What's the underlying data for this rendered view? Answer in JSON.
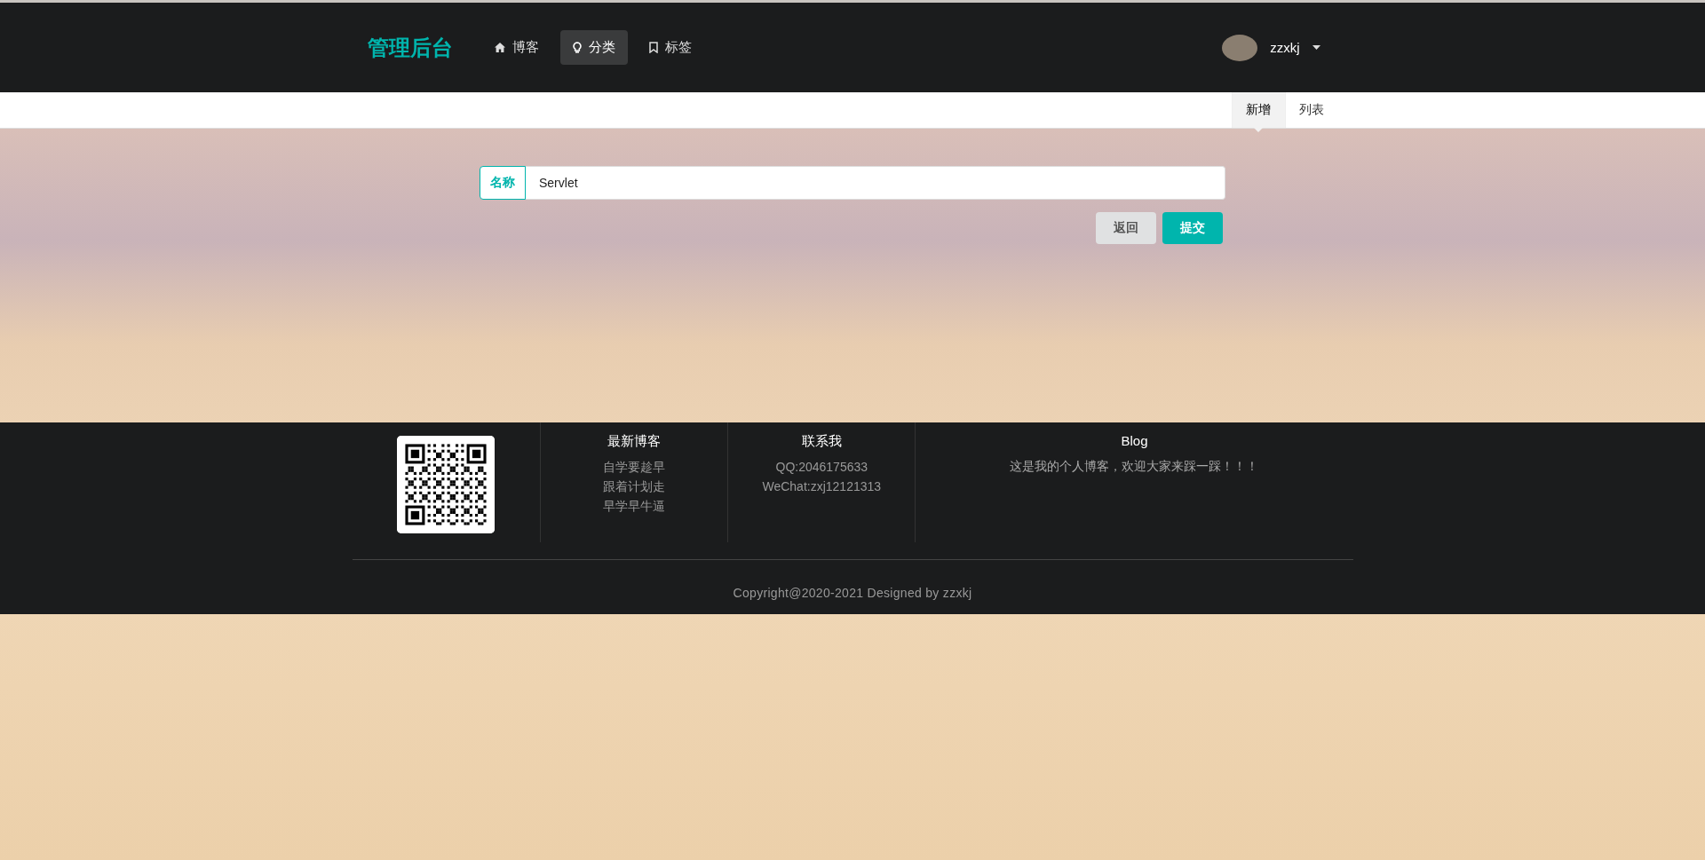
{
  "header": {
    "logo": "管理后台",
    "nav": [
      {
        "label": "博客",
        "kind": "home",
        "selected": false
      },
      {
        "label": "分类",
        "kind": "lightbulb",
        "selected": true
      },
      {
        "label": "标签",
        "kind": "bookmark",
        "selected": false
      }
    ],
    "user": {
      "name": "zzxkj"
    }
  },
  "subnav": {
    "tabs": [
      {
        "label": "新增",
        "selected": true
      },
      {
        "label": "列表",
        "selected": false
      }
    ]
  },
  "form": {
    "fields": [
      {
        "label": "名称",
        "value": "Servlet"
      }
    ],
    "buttons": [
      {
        "label": "返回",
        "kind": "secondary"
      },
      {
        "label": "提交",
        "kind": "primary"
      }
    ]
  },
  "footer": {
    "columns": [
      {
        "kind": "qr"
      },
      {
        "kind": "list",
        "title": "最新博客",
        "items": [
          "自学要趁早",
          "跟着计划走",
          "早学早牛逼"
        ]
      },
      {
        "kind": "list",
        "title": "联系我",
        "items": [
          "QQ:2046175633",
          "WeChat:zxj12121313"
        ]
      },
      {
        "kind": "text",
        "title": "Blog",
        "text": "这是我的个人博客，欢迎大家来踩一踩！！！"
      }
    ],
    "copyright": "Copyright@2020-2021 Designed by zzxkj"
  }
}
